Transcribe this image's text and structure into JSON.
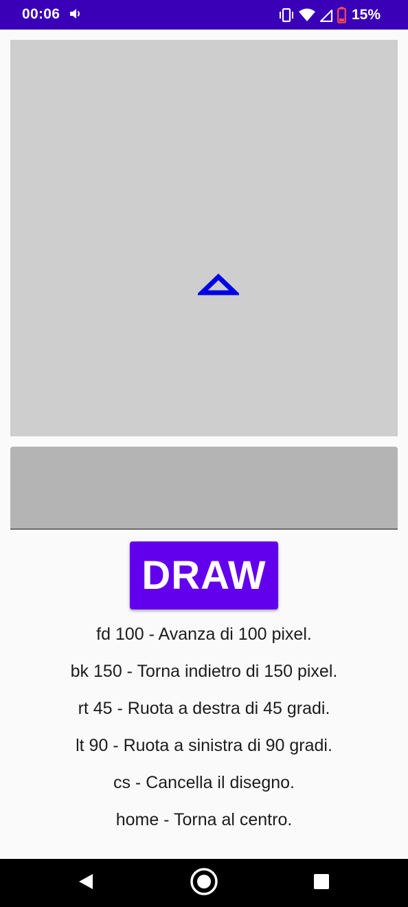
{
  "status_bar": {
    "time": "00:06",
    "battery": "15%",
    "icons": [
      "volume-icon",
      "vibrate-icon",
      "wifi-icon",
      "signal-icon",
      "battery-low-icon"
    ]
  },
  "canvas": {
    "turtle_icon": "turtle-arrow-icon",
    "turtle_color": "#0000e6",
    "background": "#cecece"
  },
  "command_input": {
    "value": "",
    "placeholder": ""
  },
  "draw_button": {
    "label": "DRAW",
    "color": "#6200ee"
  },
  "help": [
    "fd 100 - Avanza di 100 pixel.",
    "bk 150 - Torna indietro di 150 pixel.",
    "rt 45 - Ruota a destra di 45 gradi.",
    "lt 90 - Ruota a sinistra di 90 gradi.",
    "cs - Cancella il disegno.",
    "home - Torna al centro."
  ],
  "nav_bar": {
    "icons": [
      "back-icon",
      "home-icon",
      "recents-icon"
    ]
  }
}
